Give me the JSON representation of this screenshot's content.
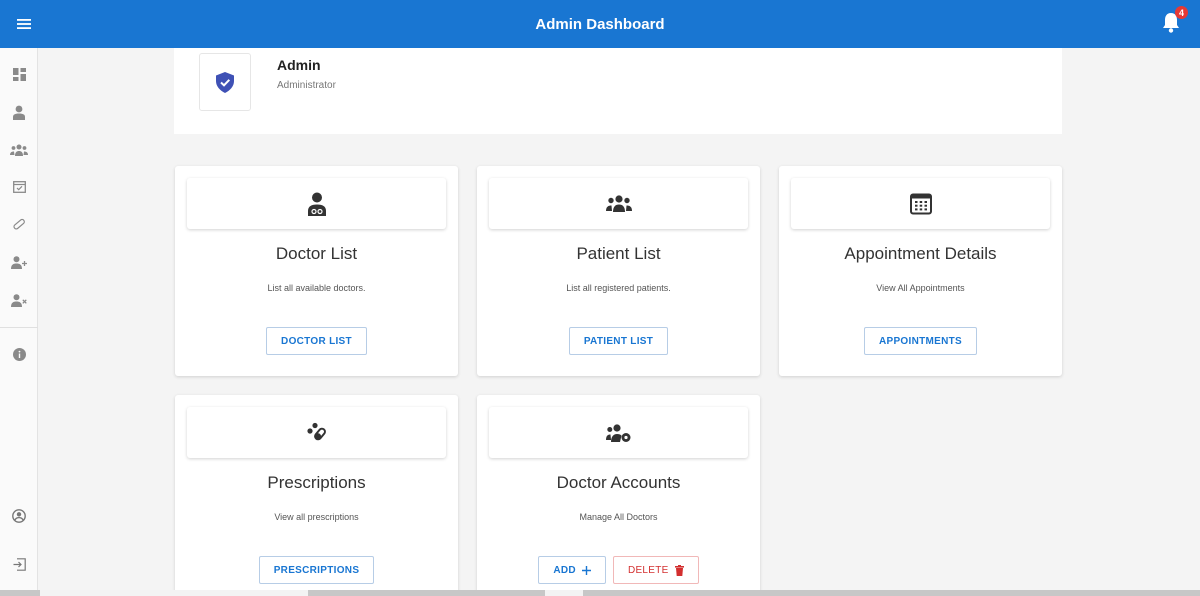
{
  "header": {
    "title": "Admin Dashboard",
    "notification_count": "4",
    "bar_color": "#1976d2"
  },
  "sidebar": {
    "items": [
      {
        "icon": "dashboard-icon"
      },
      {
        "icon": "doctor-icon"
      },
      {
        "icon": "patients-icon"
      },
      {
        "icon": "calendar-check-icon"
      },
      {
        "icon": "pills-icon"
      },
      {
        "icon": "add-user-icon"
      },
      {
        "icon": "remove-user-icon"
      },
      {
        "icon": "info-icon"
      },
      {
        "icon": "account-circle-icon"
      },
      {
        "icon": "logout-icon"
      }
    ]
  },
  "profile": {
    "name": "Admin",
    "role": "Administrator",
    "icon": "shield-check-icon"
  },
  "cards": [
    {
      "title": "Doctor List",
      "description": "List all available doctors.",
      "button": "DOCTOR LIST",
      "icon": "doctor-icon"
    },
    {
      "title": "Patient List",
      "description": "List all registered patients.",
      "button": "PATIENT LIST",
      "icon": "patients-icon"
    },
    {
      "title": "Appointment Details",
      "description": "View All Appointments",
      "button": "APPOINTMENTS",
      "icon": "calendar-icon"
    },
    {
      "title": "Prescriptions",
      "description": "View all prescriptions",
      "button": "PRESCRIPTIONS",
      "icon": "pills-icon"
    },
    {
      "title": "Doctor Accounts",
      "description": "Manage All Doctors",
      "add_button": "ADD",
      "delete_button": "DELETE",
      "icon": "users-cog-icon"
    }
  ],
  "colors": {
    "primary": "#1976d2",
    "danger": "#d32f2f",
    "shield": "#3f51b5"
  }
}
